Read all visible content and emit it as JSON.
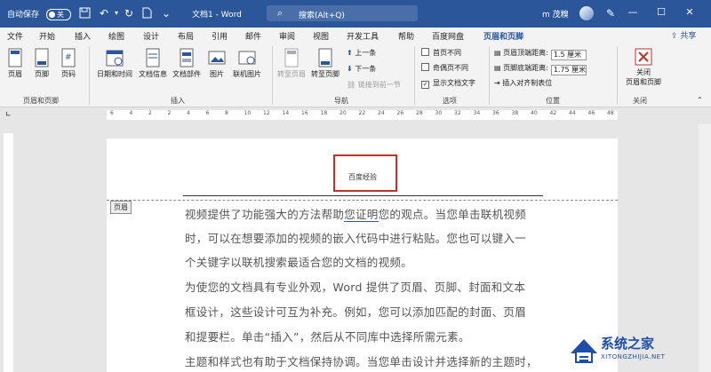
{
  "titlebar": {
    "autosave_label": "自动保存",
    "autosave_state": "关",
    "doc_title": "文档1 - Word",
    "search_placeholder": "搜索(Alt+Q)",
    "user_name": "m 茂糗",
    "win_min": "—",
    "win_max": "☐",
    "win_close": "✕"
  },
  "tabs": [
    {
      "label": "文件"
    },
    {
      "label": "开始"
    },
    {
      "label": "插入"
    },
    {
      "label": "绘图"
    },
    {
      "label": "设计"
    },
    {
      "label": "布局"
    },
    {
      "label": "引用"
    },
    {
      "label": "邮件"
    },
    {
      "label": "审阅"
    },
    {
      "label": "视图"
    },
    {
      "label": "开发工具"
    },
    {
      "label": "帮助"
    },
    {
      "label": "百度网盘"
    },
    {
      "label": "页眉和页脚",
      "active": true
    }
  ],
  "share_label": "共享",
  "ribbon": {
    "header": "页眉",
    "footer": "页脚",
    "page_number": "页码",
    "group_header_footer": "页眉和页脚",
    "date_time": "日期和时间",
    "doc_info": "文档信息",
    "doc_parts": "文档部件",
    "picture": "图片",
    "online_picture": "联机图片",
    "group_insert": "插入",
    "goto_header": "转至页眉",
    "goto_footer": "转至页脚",
    "prev_item": "上一条",
    "next_item": "下一条",
    "link_previous": "链接到前一节",
    "group_nav": "导航",
    "diff_first": "首页不同",
    "diff_odd_even": "奇偶页不同",
    "show_doc_text": "显示文档文字",
    "group_options": "选项",
    "header_top_label": "页眉顶端距离:",
    "header_top_value": "1.5 厘米",
    "footer_bottom_label": "页脚底端距离:",
    "footer_bottom_value": "1.75 厘米",
    "insert_align_tab": "插入对齐制表位",
    "group_position": "位置",
    "close_label_1": "关闭",
    "close_label_2": "页眉和页脚",
    "group_close": "关闭"
  },
  "ruler_ticks": [
    "6",
    "4",
    "2",
    "2",
    "4",
    "6",
    "8",
    "10",
    "12",
    "14",
    "16",
    "18",
    "20",
    "22",
    "24",
    "26",
    "28",
    "30",
    "32",
    "34",
    "36",
    "38",
    "40",
    "42",
    "44",
    "46",
    "48"
  ],
  "document": {
    "header_text": "百度经验",
    "header_tag": "页眉",
    "lines": [
      "视频提供了功能强大的方法帮助",
      "您证明",
      "您的观点。当您单击联机视频",
      "时，可以在想要添加的视频的嵌入代码中进行粘贴。您也可以键入一",
      "个关键字以联机搜索最适合您的文档的视频。",
      "为使您的文档具有专业外观，Word 提供了页眉、页脚、封面和文本",
      "框设计，这些设计可互为补充。例如，您可以添加匹配的封面、页眉",
      "和提要栏。单击“插入”，然后从不同库中选择所需元素。",
      "主题和样式也有助于文档保持协调。当您单击设计并选择新的主题时，"
    ]
  },
  "watermark": {
    "title": "系统之家",
    "url": "XITONGZHIJIA.NET"
  },
  "colors": {
    "word_blue": "#2b579a",
    "highlight_red": "#c0312b"
  }
}
